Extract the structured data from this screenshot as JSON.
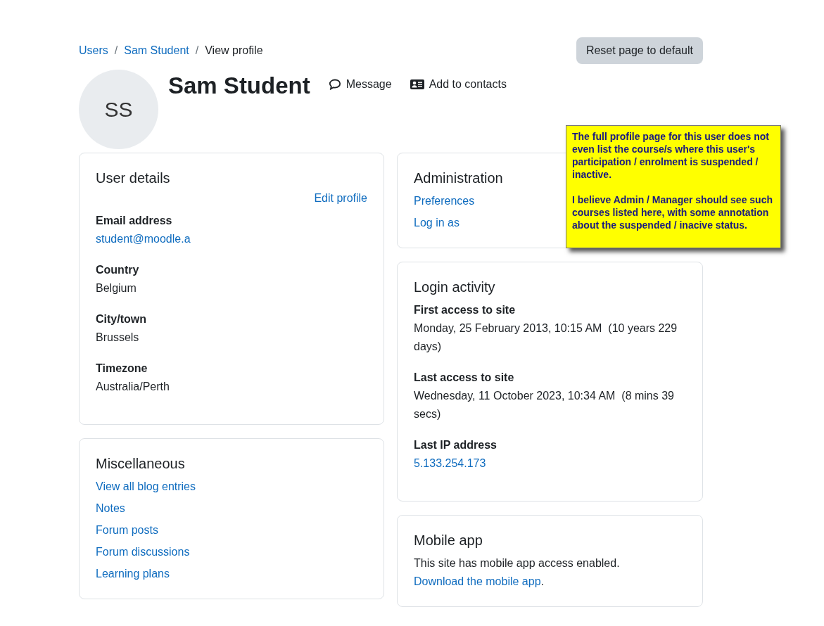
{
  "breadcrumb": [
    {
      "label": "Users",
      "kind": "link"
    },
    {
      "label": "Sam Student",
      "kind": "link"
    },
    {
      "label": "View profile",
      "kind": "current"
    }
  ],
  "breadcrumb_separator": "/",
  "reset_button": "Reset page to default",
  "profile": {
    "initials": "SS",
    "name": "Sam Student",
    "actions": [
      {
        "label": "Message",
        "kind": "message"
      },
      {
        "label": "Add to contacts",
        "kind": "contact"
      }
    ]
  },
  "left_cards": [
    {
      "title": "User details",
      "edit_link": "Edit profile",
      "fields": [
        {
          "label": "Email address",
          "value": "student@moodle.a",
          "kind": "link"
        },
        {
          "label": "Country",
          "value": "Belgium",
          "kind": "text"
        },
        {
          "label": "City/town",
          "value": "Brussels",
          "kind": "text"
        },
        {
          "label": "Timezone",
          "value": "Australia/Perth",
          "kind": "text"
        }
      ]
    },
    {
      "title": "Miscellaneous",
      "links": [
        "View all blog entries",
        "Notes",
        "Forum posts",
        "Forum discussions",
        "Learning plans"
      ]
    }
  ],
  "right_cards": [
    {
      "title": "Administration",
      "links": [
        "Preferences",
        "Log in as"
      ]
    },
    {
      "title": "Login activity",
      "fields": [
        {
          "label": "First access to site",
          "value": "Monday, 25 February 2013, 10:15 AM  (10 years 229 days)",
          "kind": "text"
        },
        {
          "label": "Last access to site",
          "value": "Wednesday, 11 October 2023, 10:34 AM  (8 mins 39 secs)",
          "kind": "text"
        },
        {
          "label": "Last IP address",
          "value": "5.133.254.173",
          "kind": "link"
        }
      ]
    },
    {
      "title": "Mobile app",
      "text": "This site has mobile app access enabled.",
      "link": "Download the mobile app",
      "after_link": "."
    }
  ],
  "note": {
    "paragraphs": [
      "The full profile page for this user does not even list the course/s where this user's participation / enrolment is suspended / inactive.",
      "I believe Admin / Manager should see such courses listed here, with some annotation about the suspended / inacive status."
    ]
  }
}
